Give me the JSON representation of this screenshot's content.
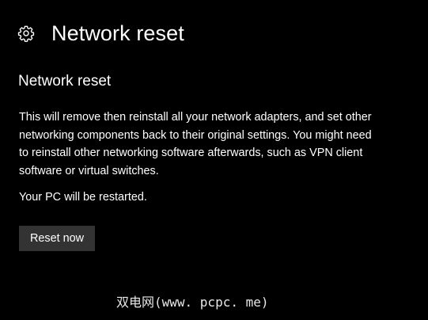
{
  "header": {
    "icon": "gear-icon",
    "title": "Network reset"
  },
  "content": {
    "section_title": "Network reset",
    "description": "This will remove then reinstall all your network adapters, and set other networking components back to their original settings. You might need to reinstall other networking software afterwards, such as VPN client software or virtual switches.",
    "restart_note": "Your PC will be restarted.",
    "reset_button_label": "Reset now"
  },
  "watermark": {
    "text": "双电网(www. pcpc. me)"
  },
  "colors": {
    "background": "#000000",
    "text": "#ffffff",
    "button_background": "#333333"
  }
}
